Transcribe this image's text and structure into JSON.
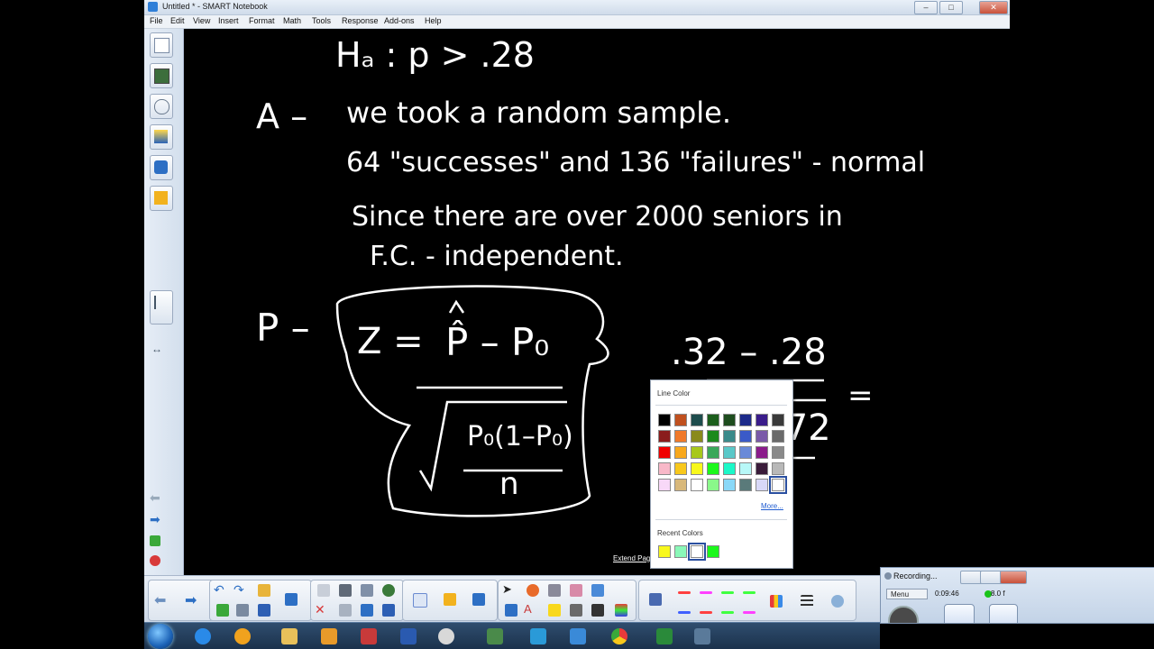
{
  "window": {
    "title": "Untitled * - SMART Notebook",
    "minimize_label": "–",
    "maximize_label": "□",
    "close_label": "✕"
  },
  "menu": [
    "File",
    "Edit",
    "View",
    "Insert",
    "Format",
    "Math",
    "Tools",
    "Response",
    "Add-ons",
    "Help"
  ],
  "canvas": {
    "lines": {
      "ha": "Hₐ : p > .28",
      "a_label": "A –",
      "a1": "we took a random sample.",
      "a2": "64 \"successes\" and 136 \"failures\" - normal",
      "a3": "Since there are over 2000 seniors in",
      "a4": "F.C. - independent.",
      "p_label": "P –",
      "z_left": "Z =",
      "z_num": "P̂ – P₀",
      "z_den": "P₀(1–P₀)",
      "z_n": "n",
      "calc_num": ".32 – .28",
      "calc_den": ".72",
      "equals": "="
    },
    "extend_page": "Extend Page"
  },
  "color_popup": {
    "title": "Line Color",
    "more": "More...",
    "recent_title": "Recent Colors",
    "grid": [
      [
        "#000000",
        "#c0501e",
        "#1e4d4d",
        "#1c5e1c",
        "#1e4d1e",
        "#1c2a8a",
        "#3a1c8a",
        "#3a3a3a"
      ],
      [
        "#8a1c1c",
        "#f07a2a",
        "#8a8a1c",
        "#1c8a1c",
        "#3a8a8a",
        "#3a5ac8",
        "#7a5aa8",
        "#6a6a6a"
      ],
      [
        "#f00000",
        "#f8a81c",
        "#a8c81c",
        "#3aa85a",
        "#5ac8c8",
        "#6a8ad8",
        "#8a1c8a",
        "#8a8a8a"
      ],
      [
        "#f8b8c8",
        "#f8c81c",
        "#f8f81c",
        "#1cf81c",
        "#1cf8c8",
        "#b8f8f8",
        "#3a1c3a",
        "#b8b8b8"
      ],
      [
        "#f8d8f8",
        "#d8b87a",
        "#ffffff",
        "#8af88a",
        "#8ad8f8",
        "#5a7a7a",
        "#d8d8f8",
        "#ffffff"
      ]
    ],
    "selected_index": [
      4,
      7
    ],
    "recent": [
      "#f8f81c",
      "#8af8b8",
      "#ffffff",
      "#1cf81c"
    ],
    "recent_selected": 2
  },
  "recorder": {
    "title": "Recording...",
    "menu": "Menu",
    "time": "0:09:46",
    "size": "8.0 f"
  },
  "toolbar": {
    "pen_colors": [
      "#ff4040",
      "#ff40ff",
      "#40ff40",
      "#40ff40",
      "#4060ff",
      "#ff4040",
      "#40ff40",
      "#ff40ff"
    ]
  }
}
